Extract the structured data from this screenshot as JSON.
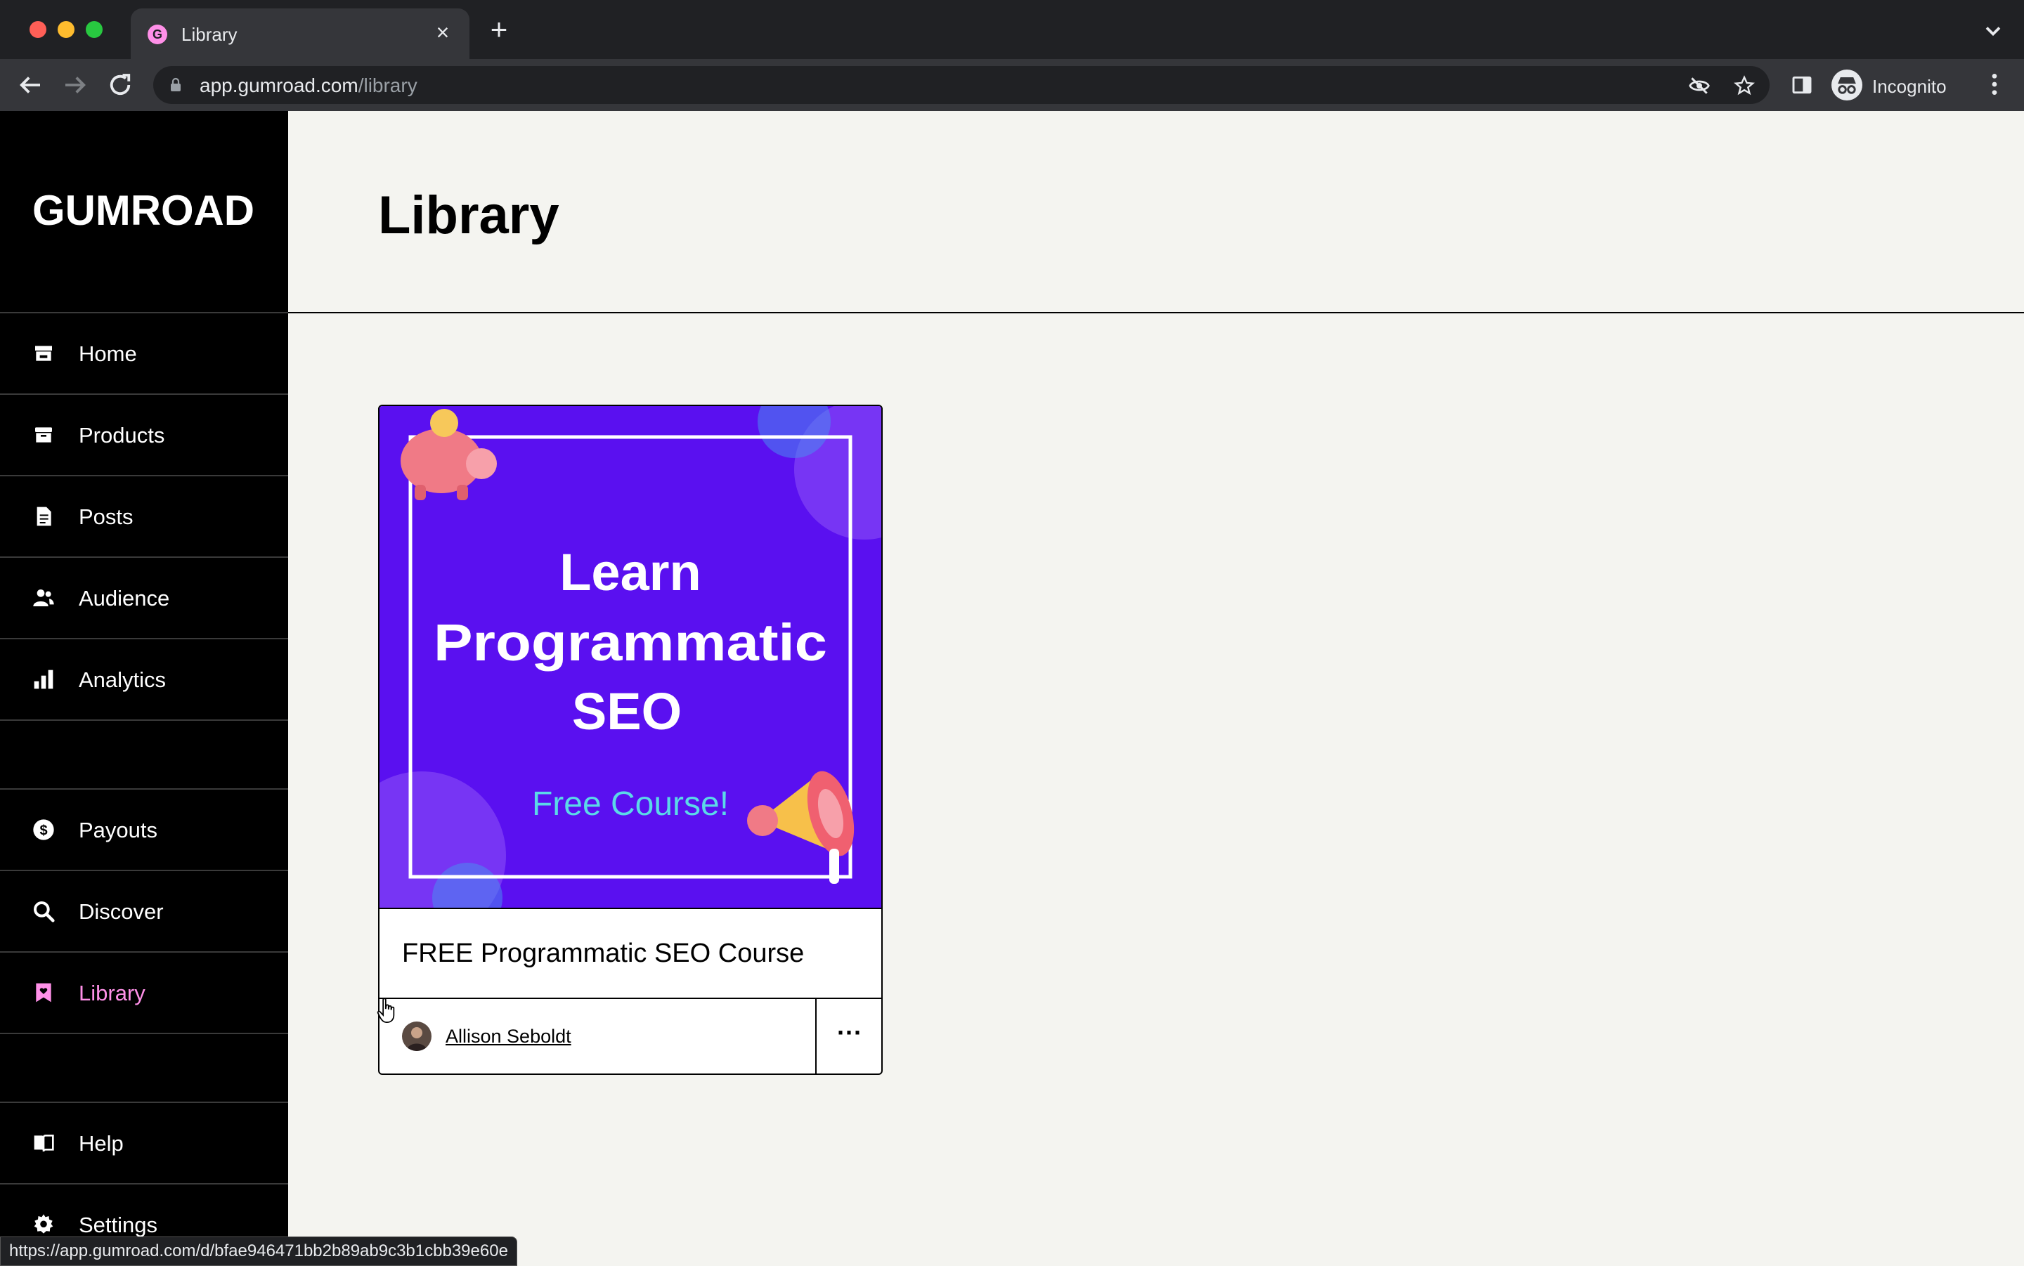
{
  "browser": {
    "tab_title": "Library",
    "tab_favicon_letter": "G",
    "url_host": "app.gumroad.com",
    "url_path": "/library",
    "profile_label": "Incognito",
    "status_url": "https://app.gumroad.com/d/bfae946471bb2b89ab9c3b1cbb39e60e"
  },
  "sidebar": {
    "logo_text": "GUMROAD",
    "items": [
      {
        "label": "Home",
        "icon": "store-icon"
      },
      {
        "label": "Products",
        "icon": "archive-icon"
      },
      {
        "label": "Posts",
        "icon": "document-icon"
      },
      {
        "label": "Audience",
        "icon": "people-icon"
      },
      {
        "label": "Analytics",
        "icon": "bar-chart-icon"
      },
      {
        "label": "Payouts",
        "icon": "dollar-circle-icon"
      },
      {
        "label": "Discover",
        "icon": "search-icon"
      },
      {
        "label": "Library",
        "icon": "bookmark-heart-icon",
        "active": true
      },
      {
        "label": "Help",
        "icon": "book-icon"
      },
      {
        "label": "Settings",
        "icon": "gear-icon"
      }
    ]
  },
  "main": {
    "page_title": "Library",
    "products": [
      {
        "title": "FREE Programmatic SEO Course",
        "creator": "Allison Seboldt",
        "thumbnail": {
          "headline_lines": [
            "Learn",
            "Programmatic",
            "SEO"
          ],
          "subline": "Free Course!",
          "background": "#5a10f0"
        }
      }
    ]
  },
  "colors": {
    "accent_pink": "#ff90e8",
    "sidebar_bg": "#000000",
    "main_bg": "#f4f4f0"
  }
}
